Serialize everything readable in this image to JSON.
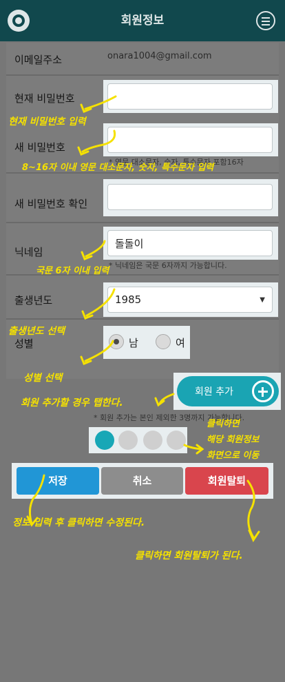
{
  "header": {
    "title": "회원정보"
  },
  "form": {
    "email_label": "이메일주소",
    "email_value": "onara1004@gmail.com",
    "current_pw_label": "현재 비밀번호",
    "new_pw_label": "새 비밀번호",
    "new_pw_hint": "* 영문 대소문자, 숫자, 특수문자 포함16자",
    "confirm_pw_label": "새 비밀번호 확인",
    "nickname_label": "닉네임",
    "nickname_value": "돌돌이",
    "nickname_hint": "* 닉네임은 국문 6자까지 가능합니다.",
    "birth_label": "출생년도",
    "birth_value": "1985",
    "gender_label": "성별",
    "gender_male": "남",
    "gender_female": "여",
    "gender_selected": "남"
  },
  "add_member": {
    "label": "회원 추가",
    "hint": "* 회원 추가는 본인 제외한 3명까지 가능합니다."
  },
  "pagination": {
    "total": 4,
    "active": 1
  },
  "actions": {
    "save": "저장",
    "cancel": "취소",
    "withdraw": "회원탈퇴"
  },
  "colors": {
    "header": "#11484d",
    "accent": "#1aa4b3",
    "save": "#2196d6",
    "cancel": "#8d8d8d",
    "withdraw": "#d9454d",
    "annotation": "#f5e100"
  },
  "annotations": {
    "current_pw": "현재 비밀번호 입력",
    "new_pw": "8~16자 이내 영문 대소문자, 숫자, 특수문자 입력",
    "nickname": "국문 6자 이내 입력",
    "birth": "출생년도 선택",
    "gender": "성별 선택",
    "add_member": "회원 추가할 경우 탭한다.",
    "pagination_1": "클릭하면",
    "pagination_2": "해당 회원정보",
    "pagination_3": "화면으로 이동",
    "save": "정보 입력 후 클릭하면 수정된다.",
    "withdraw": "클릭하면 회원탈퇴가 된다."
  }
}
